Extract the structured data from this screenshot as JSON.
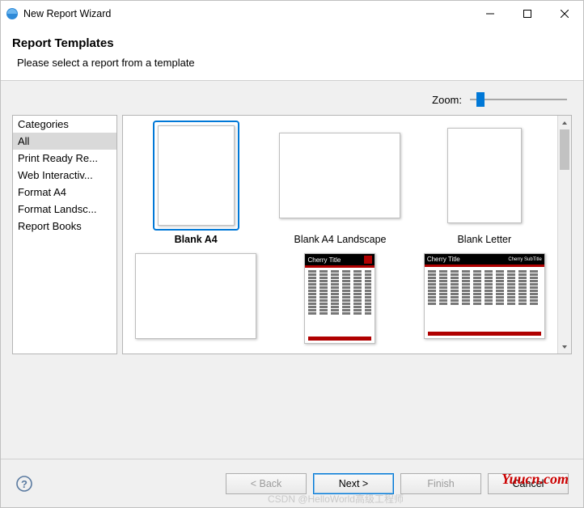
{
  "window": {
    "title": "New Report Wizard"
  },
  "header": {
    "title": "Report Templates",
    "subtitle": "Please select a report from a template"
  },
  "zoom": {
    "label": "Zoom:"
  },
  "categories": {
    "header": "Categories",
    "items": [
      "All",
      "Print Ready Re...",
      "Web Interactiv...",
      "Format A4",
      "Format Landsc...",
      "Report Books"
    ]
  },
  "templates": {
    "items": [
      {
        "label": "Blank A4"
      },
      {
        "label": "Blank A4 Landscape"
      },
      {
        "label": "Blank Letter"
      },
      {
        "label": ""
      },
      {
        "label": ""
      },
      {
        "label": ""
      }
    ],
    "cherry_title": "Cherry Title"
  },
  "buttons": {
    "back": "< Back",
    "next": "Next >",
    "finish": "Finish",
    "cancel": "Cancel"
  },
  "watermark": "Yuucn.com",
  "watermark2": "CSDN @HelloWorld高级工程师"
}
